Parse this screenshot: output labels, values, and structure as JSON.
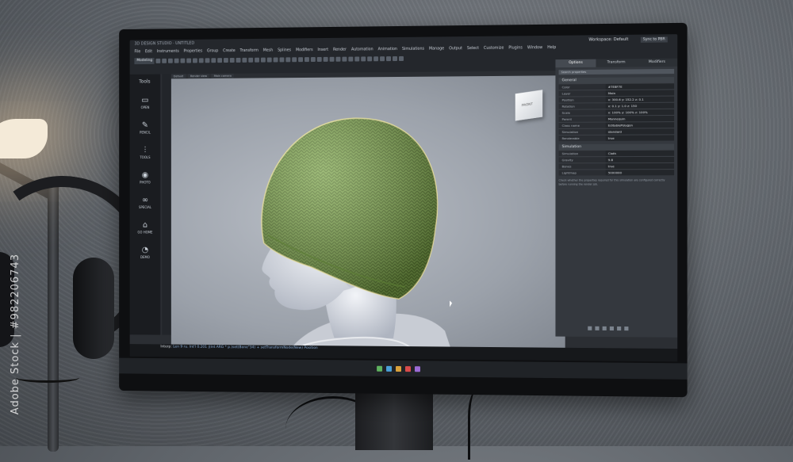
{
  "titlebar": {
    "app_title": "3D DESIGN STUDIO · UNTITLED"
  },
  "menu": [
    "File",
    "Edit",
    "Instruments",
    "Properties",
    "Group",
    "Create",
    "Transform",
    "Mesh",
    "Splines",
    "Modifiers",
    "Insert",
    "Render",
    "Automation",
    "Animation",
    "Simulations",
    "Manage",
    "Output",
    "Select",
    "Customize",
    "Plugins",
    "Window",
    "Help"
  ],
  "toolbar": {
    "mode_label": "Modeling"
  },
  "tools": {
    "title": "Tools",
    "items": [
      {
        "icon": "folder-icon",
        "glyph": "▭",
        "label": "OPEN"
      },
      {
        "icon": "pencil-icon",
        "glyph": "✎",
        "label": "PENCIL"
      },
      {
        "icon": "sliders-icon",
        "glyph": "⫶",
        "label": "TOOLS"
      },
      {
        "icon": "camera-icon",
        "glyph": "◉",
        "label": "PHOTO"
      },
      {
        "icon": "glasses-icon",
        "glyph": "∞",
        "label": "SPECIAL"
      },
      {
        "icon": "home-icon",
        "glyph": "⌂",
        "label": "GO HOME"
      },
      {
        "icon": "timer-icon",
        "glyph": "◔",
        "label": "DEMO"
      }
    ]
  },
  "viewport": {
    "tabs": [
      "Default",
      "Render view",
      "Main camera"
    ],
    "gizmo_label": "FRONT"
  },
  "console": {
    "prefix": "Interp:",
    "text": "Len 9 ru. Int'l 0.201 |(Int ARG * p.)set(Bone\"34) + setTransformNode(New) Position"
  },
  "rightpanel": {
    "workspace": "Workspace: Default",
    "sync": "Sync to PBR",
    "tabs": [
      "Options",
      "Transform",
      "Modifiers"
    ],
    "search_placeholder": "Search properties",
    "general": {
      "title": "General",
      "rows": [
        {
          "k": "Color",
          "v": "#7E8F7E"
        },
        {
          "k": "Layer",
          "v": "Main"
        },
        {
          "k": "Position",
          "v": "x: 300.6   y: 152.2   z: 0.1"
        },
        {
          "k": "Rotation",
          "v": "x: 0.1   y: 1.0   z: 150"
        },
        {
          "k": "Scale",
          "v": "x: 100%   y: 100%   z: 100%"
        },
        {
          "k": "Parent",
          "v": "Mannequin"
        },
        {
          "k": "Class name",
          "v": "EditablePolygon"
        },
        {
          "k": "Simulation",
          "v": "standard"
        },
        {
          "k": "Renderable",
          "v": "true"
        }
      ]
    },
    "simulation": {
      "title": "Simulation",
      "rows": [
        {
          "k": "Simulation",
          "v": "Cloth"
        },
        {
          "k": "Gravity",
          "v": "9.8"
        },
        {
          "k": "Bones",
          "v": "true"
        },
        {
          "k": "Lightmap",
          "v": "5000000"
        }
      ]
    },
    "note": "Check whether the properties required for this simulation are configured correctly before running the render job."
  },
  "watermark": "Adobe Stock | #982206743",
  "colors": {
    "beanie": "#7fa64d",
    "accent": "#6db33f"
  }
}
